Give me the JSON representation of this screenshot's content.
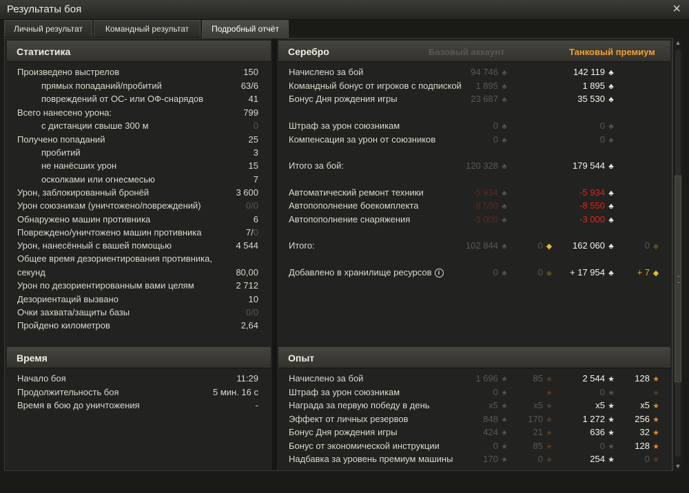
{
  "window": {
    "title": "Результаты боя"
  },
  "tabs": [
    "Личный результат",
    "Командный результат",
    "Подробный отчёт"
  ],
  "statistics": {
    "title": "Статистика",
    "rows": [
      {
        "label": "Произведено выстрелов",
        "value": "150"
      },
      {
        "label": "прямых попаданий/пробитий",
        "value": "63/6"
      },
      {
        "label": "повреждений от ОС- или ОФ-снарядов",
        "value": "41"
      },
      {
        "label": "Всего нанесено урона:",
        "value": "799"
      },
      {
        "label": "с дистанции свыше 300 м",
        "value": "0"
      },
      {
        "label": "Получено попаданий",
        "value": "25"
      },
      {
        "label": "пробитий",
        "value": "3"
      },
      {
        "label": "не нанёсших урон",
        "value": "15"
      },
      {
        "label": "осколками или огнесмесью",
        "value": "7"
      },
      {
        "label": "Урон, заблокированный бронёй",
        "value": "3 600"
      },
      {
        "label": "Урон союзникам (уничтожено/повреждений)",
        "value": "0/0"
      },
      {
        "label": "Обнаружено машин противника",
        "value": "6"
      },
      {
        "label": "Повреждено/уничтожено машин противника",
        "value": "7/0"
      },
      {
        "label": "Урон, нанесённый с вашей помощью",
        "value": "4 544"
      },
      {
        "label": "Общее время дезориентирования противника,",
        "value": ""
      },
      {
        "label": "секунд",
        "value": "80,00"
      },
      {
        "label": "Урон по дезориентированным вами целям",
        "value": "2 712"
      },
      {
        "label": "Дезориентаций вызвано",
        "value": "10"
      },
      {
        "label": "Очки захвата/защиты базы",
        "value": "0/0"
      },
      {
        "label": "Пройдено километров",
        "value": "2,64"
      }
    ]
  },
  "time": {
    "title": "Время",
    "rows": [
      {
        "label": "Начало боя",
        "value": "11:29"
      },
      {
        "label": "Продолжительность боя",
        "value": "5 мин. 16 с"
      },
      {
        "label": "Время в бою до уничтожения",
        "value": "-"
      }
    ]
  },
  "silver": {
    "title": "Серебро",
    "col_base": "Базовый аккаунт",
    "col_premium": "Танковый премиум",
    "rows": [
      {
        "label": "Начислено за бой",
        "base": "94 746",
        "prem": "142 119"
      },
      {
        "label": "Командный бонус от игроков с подпиской",
        "base": "1 895",
        "prem": "1 895"
      },
      {
        "label": "Бонус Дня рождения игры",
        "base": "23 687",
        "prem": "35 530"
      },
      {
        "label": "Штраф за урон союзникам",
        "base": "0",
        "prem": "0"
      },
      {
        "label": "Компенсация за урон от союзников",
        "base": "0",
        "prem": "0"
      },
      {
        "label": "Итого за бой:",
        "base": "120 328",
        "prem": "179 544"
      },
      {
        "label": "Автоматический ремонт техники",
        "base": "-5 934",
        "prem": "-5 934"
      },
      {
        "label": "Автопополнение боекомплекта",
        "base": "-8 550",
        "prem": "-8 550"
      },
      {
        "label": "Автопополнение снаряжения",
        "base": "-3 000",
        "prem": "-3 000"
      },
      {
        "label": "Итого:",
        "base": "102 844",
        "base_gold": "0",
        "prem": "162 060",
        "prem_gold": "0"
      },
      {
        "label": "Добавлено в хранилище ресурсов",
        "base": "0",
        "base_gold": "0",
        "prem": "+ 17 954",
        "prem_gold": "+ 7"
      }
    ]
  },
  "experience": {
    "title": "Опыт",
    "rows": [
      {
        "label": "Начислено за бой",
        "base_xp": "1 696",
        "base_fxp": "85",
        "prem_xp": "2 544",
        "prem_fxp": "128"
      },
      {
        "label": "Штраф за урон союзникам",
        "base_xp": "0",
        "base_fxp": "",
        "prem_xp": "0",
        "prem_fxp": ""
      },
      {
        "label": "Награда за первую победу в день",
        "base_xp": "x5",
        "base_fxp": "x5",
        "prem_xp": "x5",
        "prem_fxp": "x5"
      },
      {
        "label": "Эффект от личных резервов",
        "base_xp": "848",
        "base_fxp": "170",
        "prem_xp": "1 272",
        "prem_fxp": "256"
      },
      {
        "label": "Бонус Дня рождения игры",
        "base_xp": "424",
        "base_fxp": "21",
        "prem_xp": "636",
        "prem_fxp": "32"
      },
      {
        "label": "Бонус от экономической инструкции",
        "base_xp": "0",
        "base_fxp": "85",
        "prem_xp": "0",
        "prem_fxp": "128"
      },
      {
        "label": "Надбавка за уровень премиум машины",
        "base_xp": "170",
        "base_fxp": "0",
        "prem_xp": "254",
        "prem_fxp": "0"
      }
    ]
  },
  "icons": {
    "close": "close-icon",
    "credit": "credit-icon",
    "gold": "gold-icon",
    "xp": "xp-star-icon",
    "free_xp": "free-xp-star-icon",
    "info": "info-icon"
  }
}
